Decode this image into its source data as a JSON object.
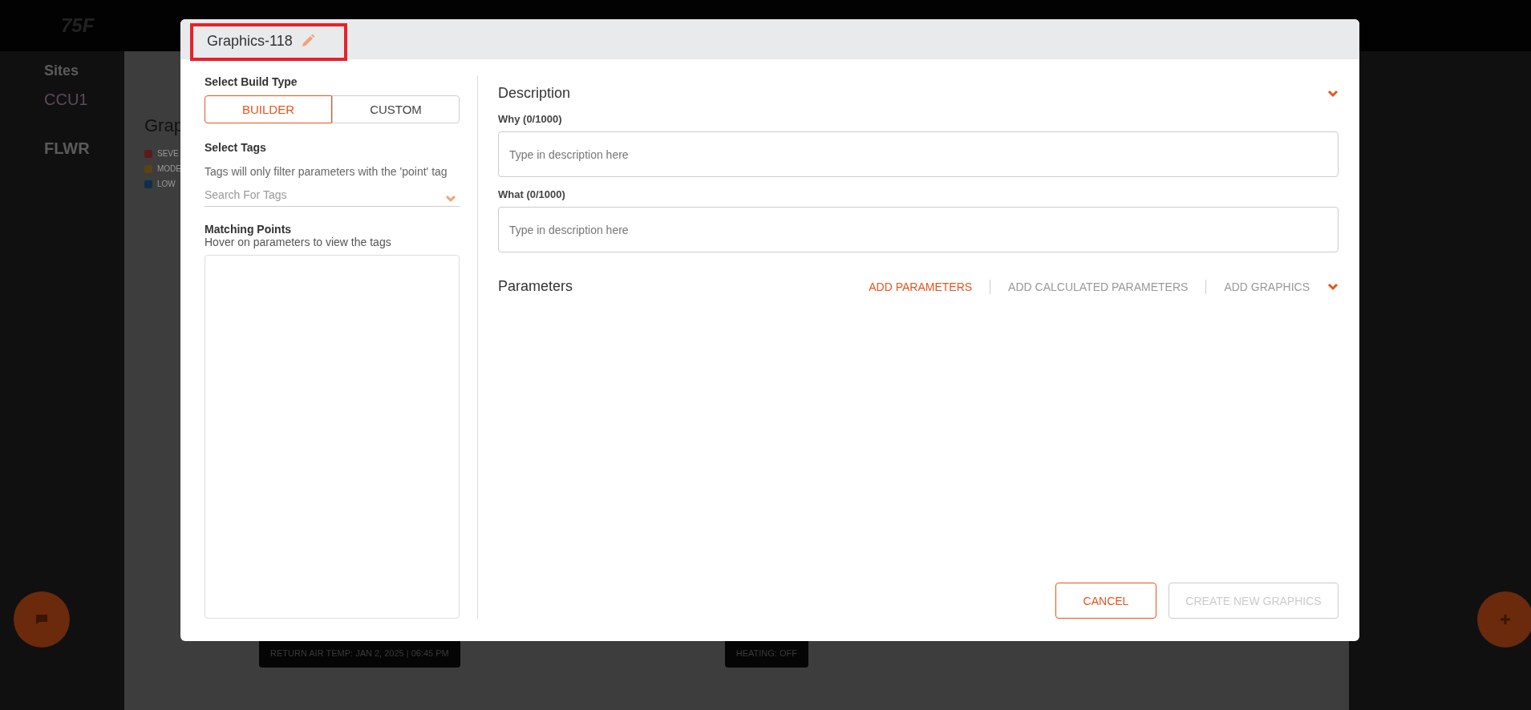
{
  "background": {
    "logo": "75F",
    "nav": "Sites",
    "breadcrumb": "CCU1",
    "floor": "FLWR",
    "panel_title": "Grap",
    "legend": [
      {
        "label": "SEVE",
        "color": "#5c1c1c"
      },
      {
        "label": "MODE",
        "color": "#5c4214"
      },
      {
        "label": "LOW",
        "color": "#0f2e4a"
      }
    ],
    "status_labels": [
      "RETURN AIR TEMP: JAN 2, 2025 | 06:45 PM",
      "HEATING: OFF"
    ]
  },
  "dialog": {
    "title": "Graphics-118",
    "title_highlighted": true,
    "build_type": {
      "label": "Select Build Type",
      "options": [
        {
          "label": "BUILDER",
          "selected": true
        },
        {
          "label": "CUSTOM",
          "selected": false
        }
      ]
    },
    "tags": {
      "label": "Select Tags",
      "hint": "Tags will only filter parameters with the 'point' tag",
      "placeholder": "Search For Tags"
    },
    "matching_points": {
      "label": "Matching Points",
      "hint": "Hover on parameters to view the tags"
    },
    "description": {
      "title": "Description",
      "fields": [
        {
          "label": "Why (0/1000)",
          "placeholder": "Type in description here"
        },
        {
          "label": "What (0/1000)",
          "placeholder": "Type in description here"
        }
      ]
    },
    "parameters": {
      "title": "Parameters",
      "actions": [
        {
          "label": "ADD PARAMETERS",
          "selected": true
        },
        {
          "label": "ADD CALCULATED PARAMETERS",
          "selected": false
        },
        {
          "label": "ADD GRAPHICS",
          "selected": false
        }
      ]
    },
    "buttons": [
      {
        "label": "CANCEL",
        "disabled": false
      },
      {
        "label": "CREATE NEW GRAPHICS",
        "disabled": true
      }
    ]
  }
}
